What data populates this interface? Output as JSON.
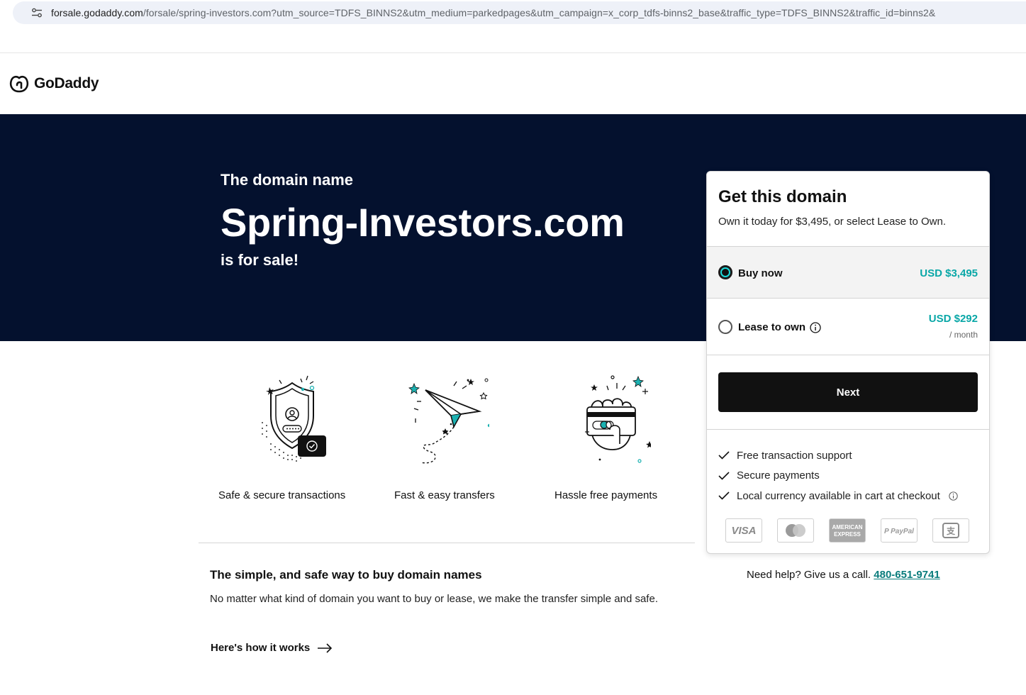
{
  "browser": {
    "url_host": "forsale.godaddy.com",
    "url_rest": "/forsale/spring-investors.com?utm_source=TDFS_BINNS2&utm_medium=parkedpages&utm_campaign=x_corp_tdfs-binns2_base&traffic_type=TDFS_BINNS2&traffic_id=binns2&",
    "site_info_icon": "tune-icon"
  },
  "header": {
    "logo_text": "GoDaddy",
    "logo_icon": "godaddy-logo-icon"
  },
  "hero": {
    "pre": "The domain name",
    "domain": "Spring-Investors.com",
    "post": "is for sale!",
    "background": "#04112e"
  },
  "features": [
    {
      "label": "Safe & secure transactions",
      "icon": "shield-icon"
    },
    {
      "label": "Fast & easy transfers",
      "icon": "paper-plane-icon"
    },
    {
      "label": "Hassle free payments",
      "icon": "card-hand-icon"
    }
  ],
  "info": {
    "title": "The simple, and safe way to buy domain names",
    "body": "No matter what kind of domain you want to buy or lease, we make the transfer simple and safe.",
    "link": "Here's how it works"
  },
  "card": {
    "title": "Get this domain",
    "subtitle": "Own it today for $3,495, or select Lease to Own.",
    "options": [
      {
        "label": "Buy now",
        "price": "USD $3,495",
        "selected": true
      },
      {
        "label": "Lease to own",
        "price": "USD $292",
        "period": "/ month",
        "selected": false
      }
    ],
    "next_label": "Next",
    "features": [
      "Free transaction support",
      "Secure payments",
      "Local currency available in cart at checkout"
    ],
    "payment_methods": [
      "VISA",
      "Mastercard",
      "American Express",
      "PayPal",
      "Alipay"
    ],
    "accent": "#09a7a7"
  },
  "help": {
    "text": "Need help? Give us a call.",
    "phone": "480-651-9741"
  }
}
